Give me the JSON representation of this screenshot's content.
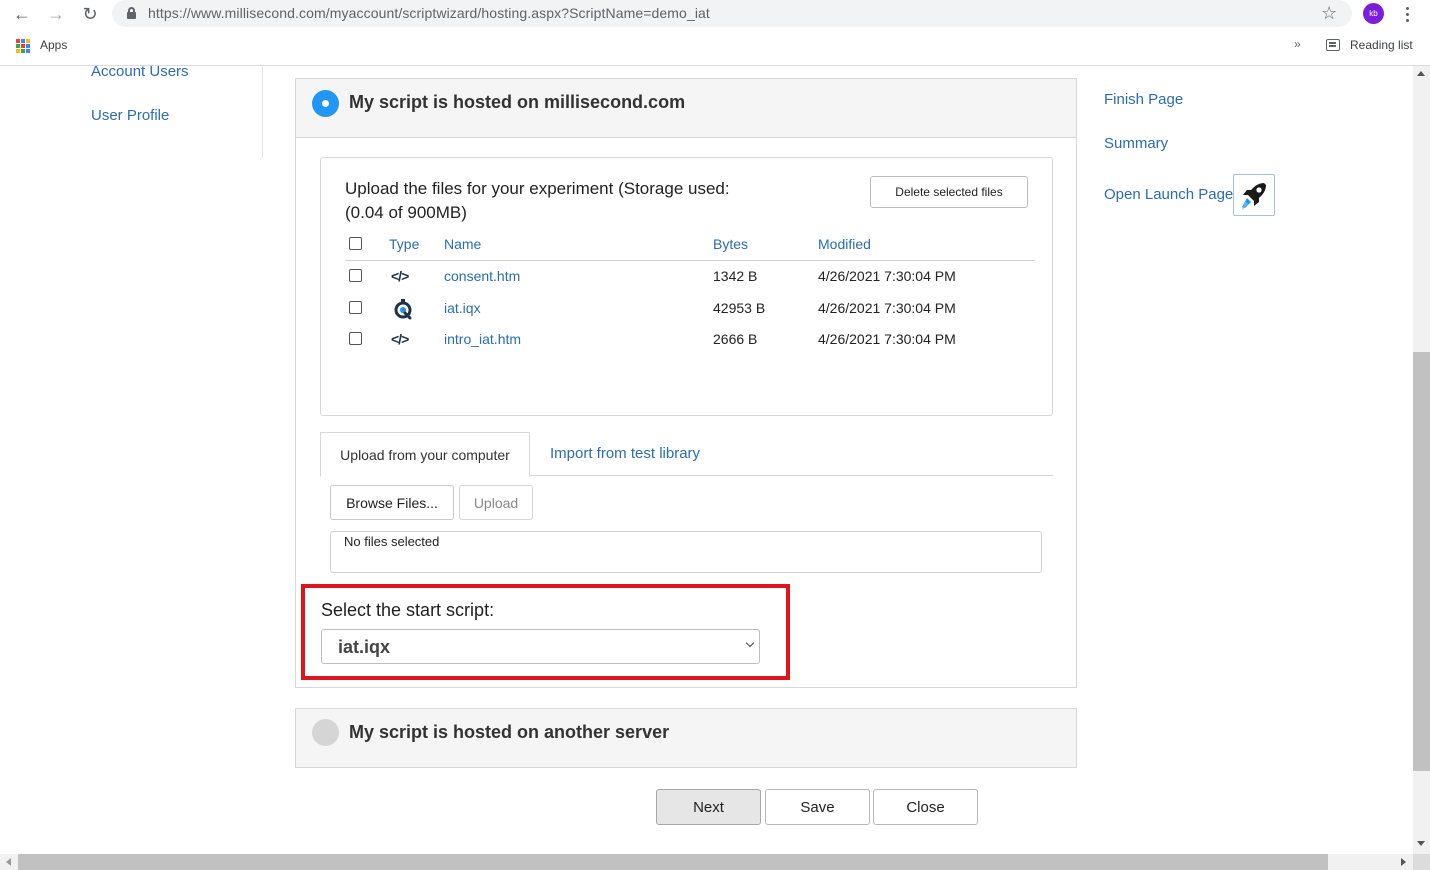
{
  "browser": {
    "url": "https://www.millisecond.com/myaccount/scriptwizard/hosting.aspx?ScriptName=demo_iat",
    "avatar_initials": "kb",
    "bookmarks_apps": "Apps",
    "overflow": "»",
    "reading_list": "Reading list"
  },
  "left_nav": {
    "items": [
      {
        "label": "Account Users"
      },
      {
        "label": "User Profile"
      }
    ]
  },
  "right_nav": {
    "items": [
      {
        "label": "Finish Page"
      },
      {
        "label": "Summary"
      },
      {
        "label": "Open Launch Page"
      }
    ]
  },
  "hosting_option_main": {
    "title": "My script is hosted on millisecond.com",
    "selected": true
  },
  "files": {
    "upload_text": "Upload the files for your experiment (Storage used: (0.04 of 900MB)",
    "delete_button": "Delete selected files",
    "columns": {
      "type": "Type",
      "name": "Name",
      "bytes": "Bytes",
      "modified": "Modified"
    },
    "rows": [
      {
        "icon": "code-icon",
        "name": "consent.htm",
        "bytes": "1342 B",
        "modified": "4/26/2021 7:30:04 PM"
      },
      {
        "icon": "inquisit-icon",
        "name": "iat.iqx",
        "bytes": "42953 B",
        "modified": "4/26/2021 7:30:04 PM"
      },
      {
        "icon": "code-icon",
        "name": "intro_iat.htm",
        "bytes": "2666 B",
        "modified": "4/26/2021 7:30:04 PM"
      }
    ]
  },
  "upload_tabs": {
    "tab_computer": "Upload from your computer",
    "tab_library": "Import from test library",
    "browse_button": "Browse Files...",
    "upload_button": "Upload",
    "no_files": "No files selected"
  },
  "start_script": {
    "label": "Select the start script:",
    "value": "iat.iqx"
  },
  "hosting_option_other": {
    "title": "My script is hosted on another server",
    "selected": false
  },
  "footer": {
    "next": "Next",
    "save": "Save",
    "close": "Close"
  },
  "colors": {
    "link": "#2a6db0",
    "radio_selected": "#2196f3",
    "highlight_border": "#e0141b",
    "avatar": "#7b1fdb"
  }
}
